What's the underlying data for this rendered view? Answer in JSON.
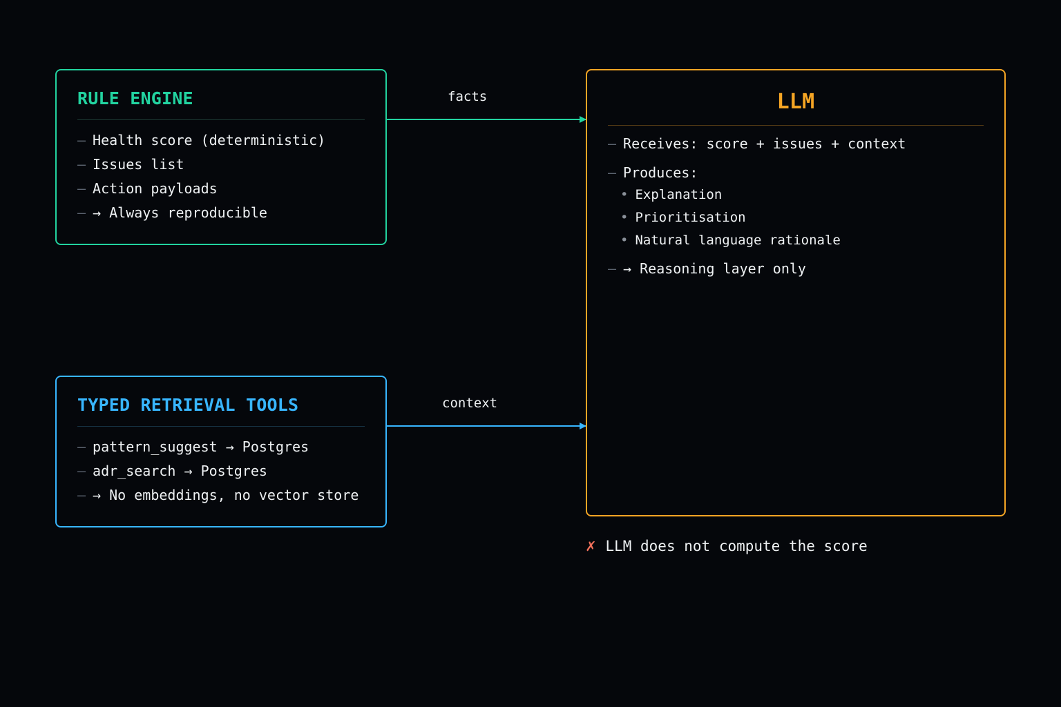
{
  "rule_engine": {
    "title": "RULE ENGINE",
    "items": [
      "Health score (deterministic)",
      "Issues list",
      "Action payloads",
      "→ Always reproducible"
    ],
    "color": "#22d3a0"
  },
  "typed_retrieval_tools": {
    "title": "TYPED RETRIEVAL TOOLS",
    "items": [
      "pattern_suggest → Postgres",
      "adr_search → Postgres",
      "→ No embeddings, no vector store"
    ],
    "color": "#38b6ff"
  },
  "llm": {
    "title": "LLM",
    "receives": "Receives: score + issues + context",
    "produces": "Produces:",
    "produces_items": [
      "Explanation",
      "Prioritisation",
      "Natural language rationale"
    ],
    "reasoning": "→ Reasoning layer only",
    "color": "#f5a524"
  },
  "edges": {
    "facts_label": "facts",
    "context_label": "context"
  },
  "note": {
    "icon": "cross-mark-icon",
    "text": "LLM does not compute the score"
  },
  "list_marker": "–",
  "sub_marker": "•"
}
